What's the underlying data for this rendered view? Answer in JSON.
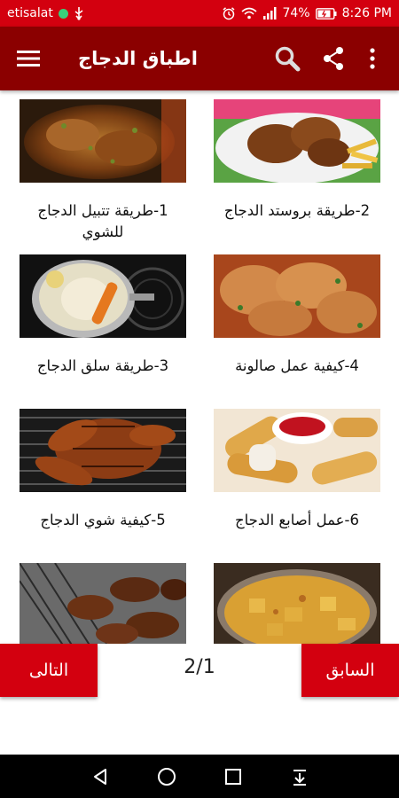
{
  "status_bar": {
    "carrier": "etisalat",
    "battery": "74%",
    "time": "8:26 PM"
  },
  "app_bar": {
    "title": "اطباق الدجاج"
  },
  "recipes": [
    {
      "title": "1-طريقة تتبيل الدجاج للشوي",
      "image": "marinated-grilled-chicken"
    },
    {
      "title": "2-طريقة بروستد الدجاج",
      "image": "broasted-chicken-fries"
    },
    {
      "title": "3-طريقة سلق الدجاج",
      "image": "boiled-chicken-pot"
    },
    {
      "title": "4-كيفية عمل صالونة",
      "image": "chicken-salona"
    },
    {
      "title": "5-كيفية شوي الدجاج",
      "image": "grilled-chicken"
    },
    {
      "title": "6-عمل أصابع الدجاج",
      "image": "chicken-fingers-ketchup"
    },
    {
      "title": "",
      "image": "bbq-chicken-grill"
    },
    {
      "title": "",
      "image": "potato-curry"
    }
  ],
  "pagination": {
    "next_label": "التالى",
    "prev_label": "السابق",
    "indicator": "2/1"
  },
  "colors": {
    "status_bar": "#d3000f",
    "app_bar": "#8b0000",
    "buttons": "#d3000f"
  }
}
